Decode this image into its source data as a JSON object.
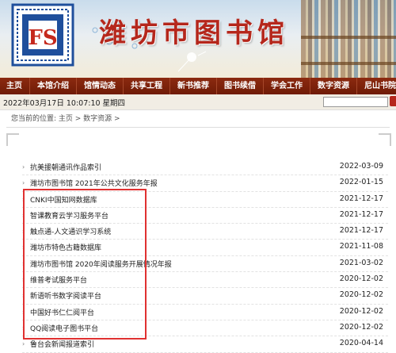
{
  "header": {
    "site_title": "潍坊市图书馆",
    "logo_letters": "FS"
  },
  "nav": {
    "items": [
      {
        "label": "主页"
      },
      {
        "label": "本馆介绍"
      },
      {
        "label": "馆情动态"
      },
      {
        "label": "共享工程"
      },
      {
        "label": "新书推荐"
      },
      {
        "label": "图书续借"
      },
      {
        "label": "学会工作"
      },
      {
        "label": "数字资源"
      },
      {
        "label": "尼山书院"
      }
    ]
  },
  "status": {
    "datetime": "2022年03月17日 10:07:10 星期四",
    "search_placeholder": ""
  },
  "breadcrumb": {
    "text": "您当前的位置: 主页 > 数字资源 >"
  },
  "list": {
    "items": [
      {
        "title": "抗美援朝通讯作品索引",
        "date": "2022-03-09"
      },
      {
        "title": "潍坊市图书馆 2021年公共文化服务年报",
        "date": "2022-01-15"
      },
      {
        "title": "CNKI中国知网数据库",
        "date": "2021-12-17"
      },
      {
        "title": "智课教育云学习服务平台",
        "date": "2021-12-17"
      },
      {
        "title": "触点通-人文通识学习系统",
        "date": "2021-12-17"
      },
      {
        "title": "潍坊市特色古籍数据库",
        "date": "2021-11-08"
      },
      {
        "title": "潍坊市图书馆 2020年阅读服务开展情况年报",
        "date": "2021-03-02"
      },
      {
        "title": "维普考试服务平台",
        "date": "2020-12-02"
      },
      {
        "title": "新语听书数字阅读平台",
        "date": "2020-12-02"
      },
      {
        "title": "中国好书仁仁阅平台",
        "date": "2020-12-02"
      },
      {
        "title": "QQ阅读电子图书平台",
        "date": "2020-12-02"
      },
      {
        "title": "鲁台会新闻报道索引",
        "date": "2020-04-14"
      }
    ]
  },
  "colors": {
    "nav_bg": "#7a2109",
    "title": "#b5271c",
    "highlight": "#e03131"
  }
}
